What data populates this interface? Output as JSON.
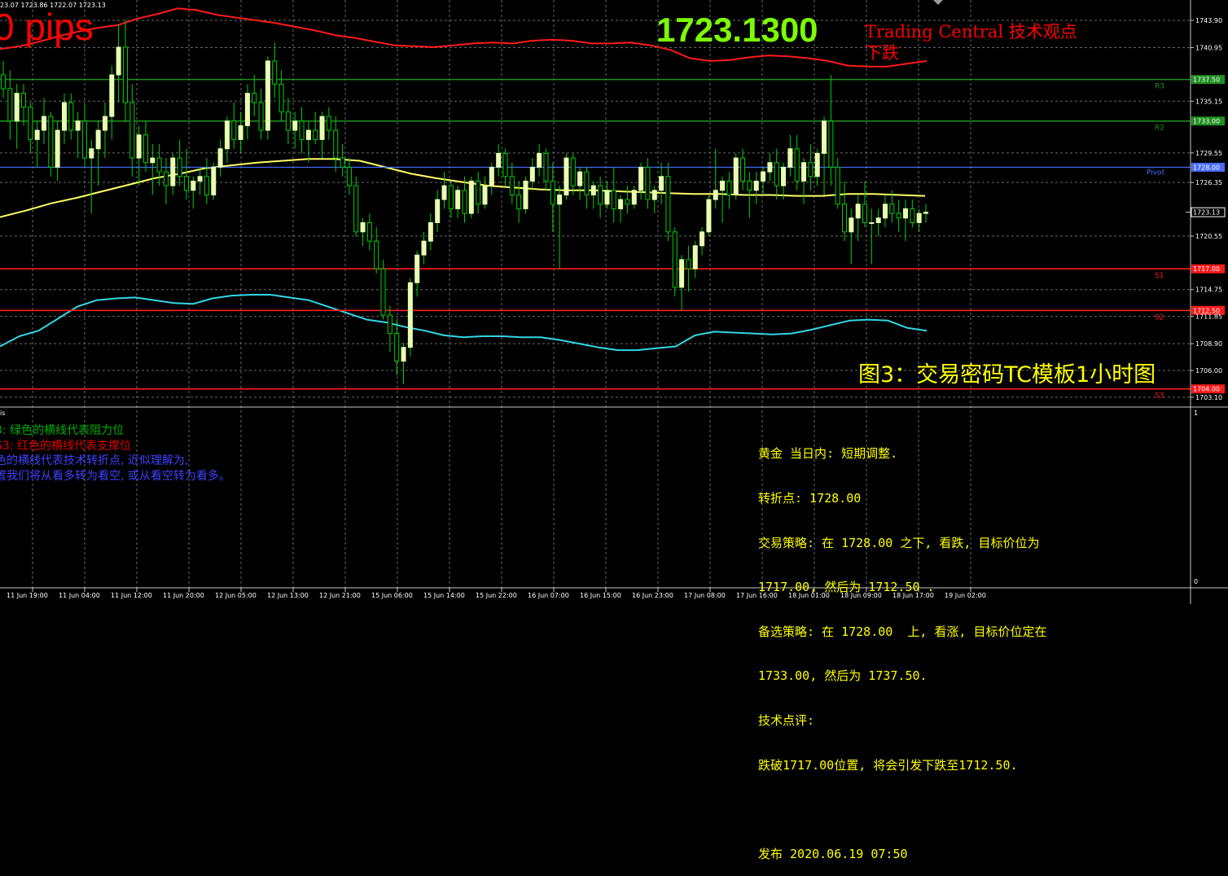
{
  "header": {
    "ohlc_text": "23.07 1723.86 1722.07 1723.13",
    "pips_text": "0 pips",
    "big_price": "1723.1300",
    "tc_text": "Trading Central 技术观点\n下跌"
  },
  "figure_title": "图3：交易密码TC模板1小时图",
  "indicator_label": "is",
  "legend": [
    {
      "text": "3: 绿色的横线代表阻力位",
      "color": "#00b000"
    },
    {
      "text": "S3: 红色的横线代表支撑位",
      "color": "#e00000"
    },
    {
      "text": "色的横线代表技术转折点, 近似理解为,",
      "color": "#4040ff"
    },
    {
      "text": "置我们将从看多转为看空, 或从看空转为看多。",
      "color": "#4040ff"
    }
  ],
  "info_lines": [
    "黄金 当日内: 短期调整.",
    "转折点: 1728.00",
    "交易策略: 在 1728.00 之下, 看跌, 目标价位为",
    "1717.00, 然后为 1712.50 .",
    "备选策略: 在 1728.00  上, 看涨, 目标价位定在",
    "1733.00, 然后为 1737.50.",
    "技术点评:",
    "跌破1717.00位置, 将会引发下跌至1712.50.",
    "",
    "发布 2020.06.19 07:50"
  ],
  "colors": {
    "background": "#000000",
    "bull_candle": "#e8ffb0",
    "wick": "#00d000",
    "grid": "#6a6a6a",
    "resistance": "#1f8f1f",
    "support": "#ff1a1a",
    "pivot": "#4a6dff",
    "ma": "#ffff66",
    "upper_band": "#ff1a1a",
    "lower_band": "#33d6e6"
  },
  "chart_data": {
    "type": "candlestick",
    "title": "",
    "ylim": [
      1702.3,
      1745.4
    ],
    "y_ticks": [
      "1743.90",
      "1740.95",
      "1737.50",
      "1735.15",
      "1733.00",
      "1729.55",
      "1728.00",
      "1726.35",
      "1723.13",
      "1720.55",
      "1717.00",
      "1714.75",
      "1712.50",
      "1711.85",
      "1708.90",
      "1706.00",
      "1704.00",
      "1703.10"
    ],
    "x_ticks": [
      "11 Jun 19:00",
      "11 Jun 04:00",
      "11 Jun 12:00",
      "11 Jun 20:00",
      "12 Jun 05:00",
      "12 Jun 13:00",
      "12 Jun 21:00",
      "15 Jun 06:00",
      "15 Jun 14:00",
      "15 Jun 22:00",
      "16 Jun 07:00",
      "16 Jun 15:00",
      "16 Jun 23:00",
      "17 Jun 08:00",
      "17 Jun 16:00",
      "18 Jun 01:00",
      "18 Jun 09:00",
      "18 Jun 17:00",
      "19 Jun 02:00"
    ],
    "levels": [
      {
        "name": "R3",
        "value": 1737.5,
        "label": "1737.50",
        "kind": "resistance"
      },
      {
        "name": "R2",
        "value": 1733.0,
        "label": "1733.00",
        "kind": "resistance"
      },
      {
        "name": "Pivot",
        "value": 1728.0,
        "label": "1728.00",
        "kind": "pivot"
      },
      {
        "name": "S1",
        "value": 1717.0,
        "label": "1717.00",
        "kind": "support"
      },
      {
        "name": "S2",
        "value": 1712.5,
        "label": "1712.50",
        "kind": "support"
      },
      {
        "name": "S3",
        "value": 1704.0,
        "label": "1704.00",
        "kind": "support"
      }
    ],
    "current_price": {
      "value": 1723.13,
      "label": "1723.13"
    },
    "indicator_panel": {
      "label": "is",
      "y_ticks": [
        "1",
        "0"
      ]
    },
    "candles": [
      [
        1738.0,
        1739.5,
        1735.5,
        1736.5
      ],
      [
        1736.5,
        1738.5,
        1731.0,
        1733.0
      ],
      [
        1733.0,
        1737.0,
        1730.0,
        1736.0
      ],
      [
        1736.0,
        1737.0,
        1732.5,
        1734.5
      ],
      [
        1734.5,
        1735.0,
        1729.5,
        1731.0
      ],
      [
        1731.0,
        1733.0,
        1728.0,
        1732.0
      ],
      [
        1732.0,
        1735.5,
        1730.5,
        1733.5
      ],
      [
        1733.5,
        1734.0,
        1727.0,
        1728.0
      ],
      [
        1728.0,
        1733.0,
        1726.5,
        1732.0
      ],
      [
        1732.0,
        1736.0,
        1730.5,
        1735.0
      ],
      [
        1735.0,
        1736.0,
        1731.0,
        1732.0
      ],
      [
        1732.0,
        1734.0,
        1729.0,
        1733.0
      ],
      [
        1733.0,
        1735.0,
        1728.0,
        1729.0
      ],
      [
        1729.0,
        1731.0,
        1723.0,
        1730.0
      ],
      [
        1730.0,
        1733.0,
        1726.0,
        1732.0
      ],
      [
        1732.0,
        1735.0,
        1729.0,
        1733.5
      ],
      [
        1733.5,
        1739.0,
        1731.0,
        1738.0
      ],
      [
        1738.0,
        1743.5,
        1735.0,
        1741.0
      ],
      [
        1741.0,
        1744.0,
        1733.0,
        1735.0
      ],
      [
        1735.0,
        1737.0,
        1727.0,
        1729.0
      ],
      [
        1729.0,
        1732.5,
        1726.0,
        1731.5
      ],
      [
        1731.5,
        1733.0,
        1727.5,
        1728.5
      ],
      [
        1728.5,
        1730.5,
        1725.0,
        1729.0
      ],
      [
        1729.0,
        1730.5,
        1726.0,
        1727.5
      ],
      [
        1727.5,
        1729.0,
        1724.0,
        1726.0
      ],
      [
        1726.0,
        1729.5,
        1725.0,
        1729.0
      ],
      [
        1729.0,
        1731.0,
        1726.0,
        1727.0
      ],
      [
        1727.0,
        1730.0,
        1724.5,
        1725.5
      ],
      [
        1725.5,
        1727.0,
        1723.5,
        1726.5
      ],
      [
        1726.5,
        1728.0,
        1725.0,
        1727.0
      ],
      [
        1727.0,
        1729.0,
        1724.0,
        1725.0
      ],
      [
        1725.0,
        1728.5,
        1724.5,
        1728.0
      ],
      [
        1728.0,
        1731.0,
        1727.0,
        1730.0
      ],
      [
        1730.0,
        1733.5,
        1728.5,
        1733.0
      ],
      [
        1733.0,
        1735.0,
        1730.0,
        1731.0
      ],
      [
        1731.0,
        1734.0,
        1729.5,
        1732.5
      ],
      [
        1732.5,
        1737.0,
        1731.0,
        1736.0
      ],
      [
        1736.0,
        1738.0,
        1733.5,
        1735.0
      ],
      [
        1735.0,
        1736.5,
        1731.0,
        1732.0
      ],
      [
        1732.0,
        1740.0,
        1731.0,
        1739.5
      ],
      [
        1739.5,
        1741.5,
        1735.5,
        1737.0
      ],
      [
        1737.0,
        1738.5,
        1733.0,
        1734.0
      ],
      [
        1734.0,
        1735.5,
        1730.5,
        1732.0
      ],
      [
        1732.0,
        1734.0,
        1730.0,
        1733.0
      ],
      [
        1733.0,
        1734.5,
        1729.5,
        1731.0
      ],
      [
        1731.0,
        1733.0,
        1728.5,
        1732.0
      ],
      [
        1732.0,
        1734.0,
        1730.5,
        1731.0
      ],
      [
        1731.0,
        1734.0,
        1729.0,
        1733.5
      ],
      [
        1733.5,
        1734.5,
        1731.0,
        1732.0
      ],
      [
        1732.0,
        1733.5,
        1727.5,
        1729.0
      ],
      [
        1729.0,
        1730.5,
        1727.0,
        1728.0
      ],
      [
        1728.0,
        1729.0,
        1725.0,
        1726.0
      ],
      [
        1726.0,
        1727.0,
        1720.5,
        1721.0
      ],
      [
        1721.0,
        1722.5,
        1719.5,
        1722.0
      ],
      [
        1722.0,
        1723.0,
        1719.0,
        1720.0
      ],
      [
        1720.0,
        1721.5,
        1716.5,
        1717.0
      ],
      [
        1717.0,
        1718.0,
        1711.5,
        1712.0
      ],
      [
        1712.0,
        1713.0,
        1708.0,
        1710.0
      ],
      [
        1710.0,
        1711.5,
        1705.5,
        1707.0
      ],
      [
        1707.0,
        1709.0,
        1704.5,
        1708.5
      ],
      [
        1708.5,
        1716.0,
        1707.5,
        1715.5
      ],
      [
        1715.5,
        1719.0,
        1714.0,
        1718.5
      ],
      [
        1718.5,
        1721.0,
        1717.5,
        1720.0
      ],
      [
        1720.0,
        1723.0,
        1719.0,
        1722.0
      ],
      [
        1722.0,
        1725.5,
        1721.0,
        1724.5
      ],
      [
        1724.5,
        1727.5,
        1723.5,
        1726.0
      ],
      [
        1726.0,
        1726.5,
        1722.5,
        1723.5
      ],
      [
        1723.5,
        1726.0,
        1722.5,
        1725.5
      ],
      [
        1725.5,
        1727.0,
        1722.0,
        1723.0
      ],
      [
        1723.0,
        1727.0,
        1722.5,
        1726.5
      ],
      [
        1726.5,
        1727.5,
        1723.0,
        1724.0
      ],
      [
        1724.0,
        1727.0,
        1723.5,
        1726.0
      ],
      [
        1726.0,
        1728.5,
        1725.0,
        1728.0
      ],
      [
        1728.0,
        1730.5,
        1727.0,
        1729.5
      ],
      [
        1729.5,
        1730.0,
        1726.0,
        1727.0
      ],
      [
        1727.0,
        1728.5,
        1724.0,
        1725.0
      ],
      [
        1725.0,
        1726.5,
        1722.0,
        1723.5
      ],
      [
        1723.5,
        1727.0,
        1723.0,
        1726.5
      ],
      [
        1726.5,
        1729.0,
        1725.5,
        1728.0
      ],
      [
        1728.0,
        1730.5,
        1727.0,
        1729.5
      ],
      [
        1729.5,
        1730.0,
        1725.5,
        1726.5
      ],
      [
        1726.5,
        1728.5,
        1721.0,
        1724.0
      ],
      [
        1724.0,
        1726.0,
        1717.0,
        1725.0
      ],
      [
        1725.0,
        1729.5,
        1724.5,
        1729.0
      ],
      [
        1729.0,
        1729.5,
        1725.0,
        1726.0
      ],
      [
        1726.0,
        1728.0,
        1724.5,
        1727.5
      ],
      [
        1727.5,
        1728.0,
        1723.5,
        1725.0
      ],
      [
        1725.0,
        1726.5,
        1723.5,
        1726.0
      ],
      [
        1726.0,
        1727.0,
        1722.5,
        1724.0
      ],
      [
        1724.0,
        1726.5,
        1723.5,
        1725.5
      ],
      [
        1725.5,
        1728.0,
        1722.0,
        1723.5
      ],
      [
        1723.5,
        1725.0,
        1722.0,
        1724.5
      ],
      [
        1724.5,
        1726.0,
        1723.0,
        1724.0
      ],
      [
        1724.0,
        1726.0,
        1723.5,
        1725.5
      ],
      [
        1725.5,
        1728.5,
        1724.5,
        1728.0
      ],
      [
        1728.0,
        1729.0,
        1723.5,
        1724.5
      ],
      [
        1724.5,
        1726.0,
        1723.0,
        1725.5
      ],
      [
        1725.5,
        1728.5,
        1724.0,
        1727.0
      ],
      [
        1727.0,
        1728.5,
        1720.0,
        1721.0
      ],
      [
        1721.0,
        1721.5,
        1714.0,
        1715.0
      ],
      [
        1715.0,
        1718.5,
        1712.5,
        1718.0
      ],
      [
        1718.0,
        1719.5,
        1714.5,
        1717.0
      ],
      [
        1717.0,
        1720.0,
        1716.0,
        1719.5
      ],
      [
        1719.5,
        1721.5,
        1718.5,
        1721.0
      ],
      [
        1721.0,
        1725.0,
        1720.5,
        1724.5
      ],
      [
        1724.5,
        1730.0,
        1723.5,
        1725.5
      ],
      [
        1725.5,
        1727.0,
        1722.0,
        1726.5
      ],
      [
        1726.5,
        1727.5,
        1723.5,
        1725.0
      ],
      [
        1725.0,
        1729.5,
        1724.5,
        1729.0
      ],
      [
        1729.0,
        1730.0,
        1725.5,
        1726.5
      ],
      [
        1726.5,
        1727.5,
        1722.5,
        1725.5
      ],
      [
        1725.5,
        1727.5,
        1724.0,
        1726.5
      ],
      [
        1726.5,
        1728.0,
        1725.0,
        1727.5
      ],
      [
        1727.5,
        1729.5,
        1726.5,
        1728.5
      ],
      [
        1728.5,
        1730.0,
        1724.5,
        1726.0
      ],
      [
        1726.0,
        1728.5,
        1724.5,
        1728.0
      ],
      [
        1728.0,
        1731.5,
        1727.0,
        1730.0
      ],
      [
        1730.0,
        1731.5,
        1725.5,
        1726.5
      ],
      [
        1726.5,
        1729.0,
        1724.0,
        1728.5
      ],
      [
        1728.5,
        1730.5,
        1725.5,
        1727.0
      ],
      [
        1727.0,
        1730.0,
        1726.0,
        1729.5
      ],
      [
        1729.5,
        1733.5,
        1725.0,
        1733.0
      ],
      [
        1733.0,
        1738.0,
        1726.0,
        1728.0
      ],
      [
        1728.0,
        1729.0,
        1723.5,
        1724.0
      ],
      [
        1724.0,
        1726.5,
        1720.0,
        1721.0
      ],
      [
        1721.0,
        1723.5,
        1717.5,
        1722.5
      ],
      [
        1722.5,
        1725.0,
        1720.0,
        1724.0
      ],
      [
        1724.0,
        1726.5,
        1721.5,
        1722.0
      ],
      [
        1722.0,
        1723.5,
        1717.5,
        1722.0
      ],
      [
        1722.0,
        1723.5,
        1720.5,
        1722.5
      ],
      [
        1722.5,
        1725.0,
        1721.5,
        1724.0
      ],
      [
        1724.0,
        1725.5,
        1722.0,
        1723.0
      ],
      [
        1723.0,
        1724.5,
        1721.0,
        1722.5
      ],
      [
        1722.5,
        1724.5,
        1720.0,
        1723.5
      ],
      [
        1723.5,
        1724.5,
        1721.5,
        1722.0
      ],
      [
        1722.0,
        1723.5,
        1721.0,
        1723.0
      ],
      [
        1723.0,
        1724.0,
        1722.0,
        1723.13
      ]
    ],
    "series": [
      {
        "name": "MA",
        "values": [
          1722.6,
          1723.3,
          1724.1,
          1724.7,
          1725.4,
          1726.1,
          1726.8,
          1727.3,
          1727.9,
          1728.2,
          1728.5,
          1728.7,
          1728.9,
          1728.9,
          1728.7,
          1728.0,
          1727.3,
          1726.8,
          1726.4,
          1726.0,
          1725.8,
          1725.6,
          1725.5,
          1725.5,
          1725.4,
          1725.3,
          1725.2,
          1725.1,
          1725.1,
          1725.0,
          1725.0,
          1724.9,
          1724.9,
          1725.1,
          1725.1,
          1725.0,
          1724.9
        ]
      },
      {
        "name": "Upper band",
        "values": [
          1740.8,
          1741.1,
          1741.6,
          1742.2,
          1742.7,
          1743.1,
          1743.4,
          1744.1,
          1744.6,
          1745.2,
          1745.0,
          1744.5,
          1744.2,
          1743.9,
          1743.6,
          1743.2,
          1742.8,
          1742.3,
          1742.0,
          1741.6,
          1741.2,
          1741.1,
          1741.0,
          1741.2,
          1741.4,
          1741.5,
          1741.4,
          1741.7,
          1741.8,
          1741.7,
          1741.4,
          1741.4,
          1741.5,
          1741.2,
          1740.7,
          1739.8,
          1739.5,
          1739.6,
          1739.9,
          1740.1,
          1740.0,
          1739.8,
          1739.5,
          1739.0,
          1738.9,
          1738.9,
          1739.2,
          1739.5
        ]
      },
      {
        "name": "Lower band",
        "values": [
          1708.6,
          1709.7,
          1710.3,
          1711.6,
          1712.9,
          1713.6,
          1713.8,
          1713.9,
          1713.6,
          1713.3,
          1713.2,
          1713.8,
          1714.1,
          1714.2,
          1714.2,
          1713.9,
          1713.6,
          1712.9,
          1712.2,
          1711.5,
          1711.2,
          1710.7,
          1710.3,
          1709.8,
          1709.6,
          1709.7,
          1709.7,
          1709.6,
          1709.6,
          1709.3,
          1708.9,
          1708.5,
          1708.2,
          1708.2,
          1708.4,
          1708.6,
          1709.8,
          1710.2,
          1710.1,
          1710.0,
          1709.9,
          1710.0,
          1710.4,
          1710.9,
          1711.4,
          1711.5,
          1711.4,
          1710.6,
          1710.3
        ]
      }
    ]
  }
}
